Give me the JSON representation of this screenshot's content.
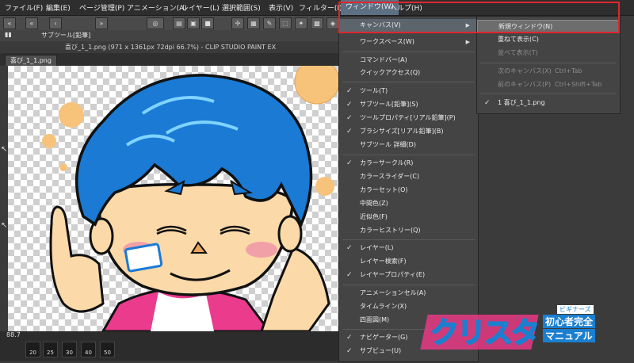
{
  "menubar": {
    "items": [
      "ファイル(F)",
      "編集(E)",
      "ページ管理(P)",
      "アニメーション(A)",
      "レイヤー(L)",
      "選択範囲(S)",
      "表示(V)",
      "フィルター(I)",
      "ウィンドウ(W)",
      "ヘルプ(H)"
    ]
  },
  "toolbar": {
    "subtool_label": "サブツール[鉛筆]"
  },
  "document": {
    "title": "喜び_1_1.png (971 x 1361px 72dpi 66.7%)  - CLIP STUDIO PAINT EX",
    "tab": "喜び_1_1.png",
    "zoom": "88.7",
    "brush_sizes": [
      "20",
      "25",
      "30",
      "40",
      "50"
    ]
  },
  "window_menu": {
    "items": [
      {
        "label": "キャンバス(V)",
        "submenu": true,
        "highlight": true
      },
      {
        "label": "ワークスペース(W)",
        "submenu": true
      },
      {
        "label": "コマンドバー(A)"
      },
      {
        "label": "クイックアクセス(Q)"
      },
      {
        "label": "ツール(T)",
        "checked": true
      },
      {
        "label": "サブツール[鉛筆](S)",
        "checked": true
      },
      {
        "label": "ツールプロパティ[リアル鉛筆](P)",
        "checked": true
      },
      {
        "label": "ブラシサイズ[リアル鉛筆](B)",
        "checked": true
      },
      {
        "label": "サブツール 詳細(D)"
      },
      {
        "label": "カラーサークル(R)",
        "checked": true
      },
      {
        "label": "カラースライダー(C)"
      },
      {
        "label": "カラーセット(O)"
      },
      {
        "label": "中間色(Z)"
      },
      {
        "label": "近似色(F)"
      },
      {
        "label": "カラーヒストリー(Q)"
      },
      {
        "label": "レイヤー(L)",
        "checked": true
      },
      {
        "label": "レイヤー検索(F)"
      },
      {
        "label": "レイヤープロパティ(E)",
        "checked": true
      },
      {
        "label": "アニメーションセル(A)"
      },
      {
        "label": "タイムライン(X)"
      },
      {
        "label": "四面図(M)"
      },
      {
        "label": "ナビゲーター(G)",
        "checked": true
      },
      {
        "label": "サブビュー(U)",
        "checked": true
      }
    ]
  },
  "canvas_submenu": {
    "items": [
      {
        "label": "新規ウィンドウ(N)",
        "highlight": true
      },
      {
        "label": "重ねて表示(C)"
      },
      {
        "label": "並べて表示(T)",
        "disabled": true
      },
      {
        "label": "次のキャンバス(X)",
        "shortcut": "Ctrl+Tab",
        "disabled": true
      },
      {
        "label": "前のキャンバス(P)",
        "shortcut": "Ctrl+Shift+Tab",
        "disabled": true
      },
      {
        "label": "1 喜び_1_1.png",
        "checked": true
      }
    ]
  },
  "watermark": {
    "logo_text": "クリスタ",
    "tag": "ビギナーズ",
    "line1": "初心者完全",
    "line2": "マニュアル"
  },
  "colors": {
    "highlight_border": "#e0262d",
    "hair": "#1a7ad4",
    "skin": "#fbd9a8",
    "shirt": "#ea3b8c",
    "bubble": "#f7c27a"
  }
}
